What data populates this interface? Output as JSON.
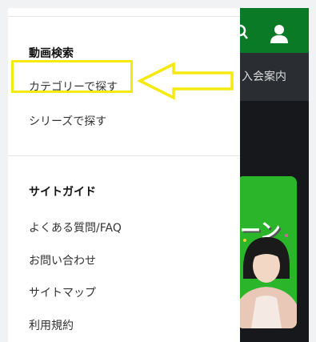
{
  "background": {
    "header_color": "#0b7a27",
    "subbar_text": "入会案内",
    "banner_text": "ーン",
    "icons": [
      "search-icon",
      "user-icon"
    ]
  },
  "drawer": {
    "video_search": {
      "heading": "動画検索",
      "items": [
        {
          "label": "カテゴリーで探す"
        },
        {
          "label": "シリーズで探す"
        }
      ]
    },
    "site_guide": {
      "heading": "サイトガイド",
      "items": [
        {
          "label": "よくある質問/FAQ"
        },
        {
          "label": "お問い合わせ"
        },
        {
          "label": "サイトマップ"
        },
        {
          "label": "利用規約"
        }
      ]
    }
  },
  "annotation": {
    "highlight_color": "#f5ea10",
    "target": "カテゴリーで探す"
  }
}
